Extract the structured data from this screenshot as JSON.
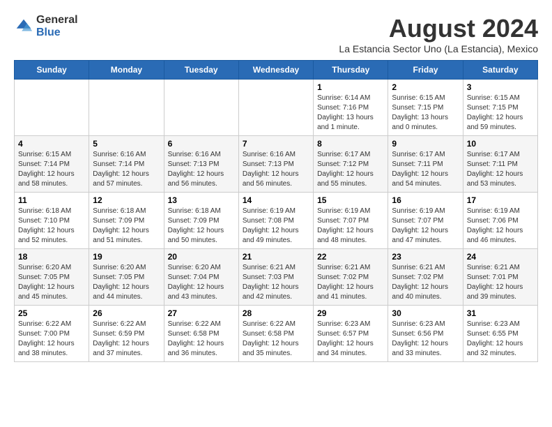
{
  "header": {
    "logo_general": "General",
    "logo_blue": "Blue",
    "month_title": "August 2024",
    "subtitle": "La Estancia Sector Uno (La Estancia), Mexico"
  },
  "weekdays": [
    "Sunday",
    "Monday",
    "Tuesday",
    "Wednesday",
    "Thursday",
    "Friday",
    "Saturday"
  ],
  "weeks": [
    [
      {
        "day": "",
        "info": ""
      },
      {
        "day": "",
        "info": ""
      },
      {
        "day": "",
        "info": ""
      },
      {
        "day": "",
        "info": ""
      },
      {
        "day": "1",
        "info": "Sunrise: 6:14 AM\nSunset: 7:16 PM\nDaylight: 13 hours\nand 1 minute."
      },
      {
        "day": "2",
        "info": "Sunrise: 6:15 AM\nSunset: 7:15 PM\nDaylight: 13 hours\nand 0 minutes."
      },
      {
        "day": "3",
        "info": "Sunrise: 6:15 AM\nSunset: 7:15 PM\nDaylight: 12 hours\nand 59 minutes."
      }
    ],
    [
      {
        "day": "4",
        "info": "Sunrise: 6:15 AM\nSunset: 7:14 PM\nDaylight: 12 hours\nand 58 minutes."
      },
      {
        "day": "5",
        "info": "Sunrise: 6:16 AM\nSunset: 7:14 PM\nDaylight: 12 hours\nand 57 minutes."
      },
      {
        "day": "6",
        "info": "Sunrise: 6:16 AM\nSunset: 7:13 PM\nDaylight: 12 hours\nand 56 minutes."
      },
      {
        "day": "7",
        "info": "Sunrise: 6:16 AM\nSunset: 7:13 PM\nDaylight: 12 hours\nand 56 minutes."
      },
      {
        "day": "8",
        "info": "Sunrise: 6:17 AM\nSunset: 7:12 PM\nDaylight: 12 hours\nand 55 minutes."
      },
      {
        "day": "9",
        "info": "Sunrise: 6:17 AM\nSunset: 7:11 PM\nDaylight: 12 hours\nand 54 minutes."
      },
      {
        "day": "10",
        "info": "Sunrise: 6:17 AM\nSunset: 7:11 PM\nDaylight: 12 hours\nand 53 minutes."
      }
    ],
    [
      {
        "day": "11",
        "info": "Sunrise: 6:18 AM\nSunset: 7:10 PM\nDaylight: 12 hours\nand 52 minutes."
      },
      {
        "day": "12",
        "info": "Sunrise: 6:18 AM\nSunset: 7:09 PM\nDaylight: 12 hours\nand 51 minutes."
      },
      {
        "day": "13",
        "info": "Sunrise: 6:18 AM\nSunset: 7:09 PM\nDaylight: 12 hours\nand 50 minutes."
      },
      {
        "day": "14",
        "info": "Sunrise: 6:19 AM\nSunset: 7:08 PM\nDaylight: 12 hours\nand 49 minutes."
      },
      {
        "day": "15",
        "info": "Sunrise: 6:19 AM\nSunset: 7:07 PM\nDaylight: 12 hours\nand 48 minutes."
      },
      {
        "day": "16",
        "info": "Sunrise: 6:19 AM\nSunset: 7:07 PM\nDaylight: 12 hours\nand 47 minutes."
      },
      {
        "day": "17",
        "info": "Sunrise: 6:19 AM\nSunset: 7:06 PM\nDaylight: 12 hours\nand 46 minutes."
      }
    ],
    [
      {
        "day": "18",
        "info": "Sunrise: 6:20 AM\nSunset: 7:05 PM\nDaylight: 12 hours\nand 45 minutes."
      },
      {
        "day": "19",
        "info": "Sunrise: 6:20 AM\nSunset: 7:05 PM\nDaylight: 12 hours\nand 44 minutes."
      },
      {
        "day": "20",
        "info": "Sunrise: 6:20 AM\nSunset: 7:04 PM\nDaylight: 12 hours\nand 43 minutes."
      },
      {
        "day": "21",
        "info": "Sunrise: 6:21 AM\nSunset: 7:03 PM\nDaylight: 12 hours\nand 42 minutes."
      },
      {
        "day": "22",
        "info": "Sunrise: 6:21 AM\nSunset: 7:02 PM\nDaylight: 12 hours\nand 41 minutes."
      },
      {
        "day": "23",
        "info": "Sunrise: 6:21 AM\nSunset: 7:02 PM\nDaylight: 12 hours\nand 40 minutes."
      },
      {
        "day": "24",
        "info": "Sunrise: 6:21 AM\nSunset: 7:01 PM\nDaylight: 12 hours\nand 39 minutes."
      }
    ],
    [
      {
        "day": "25",
        "info": "Sunrise: 6:22 AM\nSunset: 7:00 PM\nDaylight: 12 hours\nand 38 minutes."
      },
      {
        "day": "26",
        "info": "Sunrise: 6:22 AM\nSunset: 6:59 PM\nDaylight: 12 hours\nand 37 minutes."
      },
      {
        "day": "27",
        "info": "Sunrise: 6:22 AM\nSunset: 6:58 PM\nDaylight: 12 hours\nand 36 minutes."
      },
      {
        "day": "28",
        "info": "Sunrise: 6:22 AM\nSunset: 6:58 PM\nDaylight: 12 hours\nand 35 minutes."
      },
      {
        "day": "29",
        "info": "Sunrise: 6:23 AM\nSunset: 6:57 PM\nDaylight: 12 hours\nand 34 minutes."
      },
      {
        "day": "30",
        "info": "Sunrise: 6:23 AM\nSunset: 6:56 PM\nDaylight: 12 hours\nand 33 minutes."
      },
      {
        "day": "31",
        "info": "Sunrise: 6:23 AM\nSunset: 6:55 PM\nDaylight: 12 hours\nand 32 minutes."
      }
    ]
  ]
}
